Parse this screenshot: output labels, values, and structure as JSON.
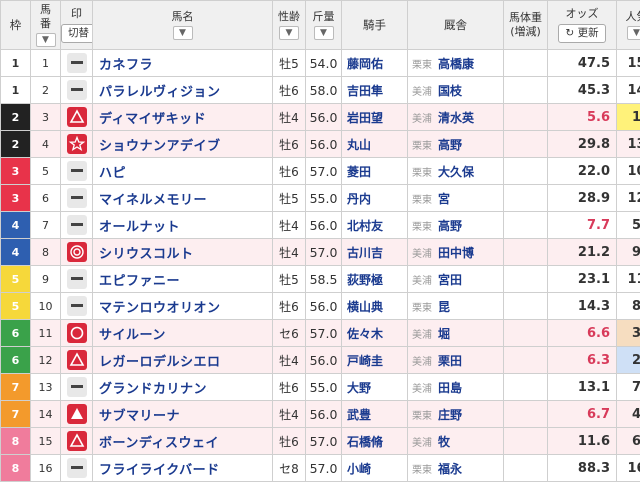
{
  "header": {
    "waku": "枠",
    "uma_top": "馬",
    "uma_bottom": "番",
    "mark_label": "印",
    "mark_toggle": "切替",
    "name": "馬名",
    "sex_age": "性齢",
    "kinryo": "斤量",
    "jockey": "騎手",
    "trainer": "厩舎",
    "weight_top": "馬体重",
    "weight_bottom": "(増減)",
    "odds": "オッズ",
    "update": "更新",
    "ninki": "人気"
  },
  "colors": {
    "waku": {
      "1": {
        "bg": "#ffffff",
        "fg": "#333333"
      },
      "2": {
        "bg": "#222222",
        "fg": "#ffffff"
      },
      "3": {
        "bg": "#e8334a",
        "fg": "#ffffff"
      },
      "4": {
        "bg": "#2e5fb0",
        "fg": "#ffffff"
      },
      "5": {
        "bg": "#f6d83a",
        "fg": "#ffffff"
      },
      "6": {
        "bg": "#3aa24a",
        "fg": "#ffffff"
      },
      "7": {
        "bg": "#f39a2c",
        "fg": "#ffffff"
      },
      "8": {
        "bg": "#f07c9c",
        "fg": "#ffffff"
      }
    },
    "ninki": {
      "1": "#fff27a",
      "2": "#cfe0f6",
      "3": "#f6ddc0"
    }
  },
  "rows": [
    {
      "waku": "1",
      "uma": "1",
      "mark": "none",
      "name": "カネフラ",
      "sex": "牡5",
      "kin": "54.0",
      "jockey": "藤岡佑",
      "area": "栗東",
      "trainer": "高橋康",
      "odds": "47.5",
      "hot": false,
      "ninki": "15",
      "pick": false
    },
    {
      "waku": "1",
      "uma": "2",
      "mark": "none",
      "name": "パラレルヴィジョン",
      "sex": "牡6",
      "kin": "58.0",
      "jockey": "吉田隼",
      "area": "美浦",
      "trainer": "国枝",
      "odds": "45.3",
      "hot": false,
      "ninki": "14",
      "pick": false
    },
    {
      "waku": "2",
      "uma": "3",
      "mark": "triangle",
      "name": "ディマイザキッド",
      "sex": "牡4",
      "kin": "56.0",
      "jockey": "岩田望",
      "area": "美浦",
      "trainer": "清水英",
      "odds": "5.6",
      "hot": true,
      "ninki": "1",
      "pick": true
    },
    {
      "waku": "2",
      "uma": "4",
      "mark": "star",
      "name": "ショウナンアデイブ",
      "sex": "牡6",
      "kin": "56.0",
      "jockey": "丸山",
      "area": "栗東",
      "trainer": "高野",
      "odds": "29.8",
      "hot": false,
      "ninki": "13",
      "pick": true
    },
    {
      "waku": "3",
      "uma": "5",
      "mark": "none",
      "name": "ハピ",
      "sex": "牡6",
      "kin": "57.0",
      "jockey": "菱田",
      "area": "栗東",
      "trainer": "大久保",
      "odds": "22.0",
      "hot": false,
      "ninki": "10",
      "pick": false
    },
    {
      "waku": "3",
      "uma": "6",
      "mark": "none",
      "name": "マイネルメモリー",
      "sex": "牡5",
      "kin": "55.0",
      "jockey": "丹内",
      "area": "栗東",
      "trainer": "宮",
      "odds": "28.9",
      "hot": false,
      "ninki": "12",
      "pick": false
    },
    {
      "waku": "4",
      "uma": "7",
      "mark": "none",
      "name": "オールナット",
      "sex": "牡4",
      "kin": "56.0",
      "jockey": "北村友",
      "area": "栗東",
      "trainer": "高野",
      "odds": "7.7",
      "hot": true,
      "ninki": "5",
      "pick": false
    },
    {
      "waku": "4",
      "uma": "8",
      "mark": "double",
      "name": "シリウスコルト",
      "sex": "牡4",
      "kin": "57.0",
      "jockey": "古川吉",
      "area": "美浦",
      "trainer": "田中博",
      "odds": "21.2",
      "hot": false,
      "ninki": "9",
      "pick": true
    },
    {
      "waku": "5",
      "uma": "9",
      "mark": "none",
      "name": "エピファニー",
      "sex": "牡5",
      "kin": "58.5",
      "jockey": "荻野極",
      "area": "美浦",
      "trainer": "宮田",
      "odds": "23.1",
      "hot": false,
      "ninki": "11",
      "pick": false
    },
    {
      "waku": "5",
      "uma": "10",
      "mark": "none",
      "name": "マテンロウオリオン",
      "sex": "牡6",
      "kin": "56.0",
      "jockey": "横山典",
      "area": "栗東",
      "trainer": "昆",
      "odds": "14.3",
      "hot": false,
      "ninki": "8",
      "pick": false
    },
    {
      "waku": "6",
      "uma": "11",
      "mark": "circle",
      "name": "サイルーン",
      "sex": "セ6",
      "kin": "57.0",
      "jockey": "佐々木",
      "area": "美浦",
      "trainer": "堀",
      "odds": "6.6",
      "hot": true,
      "ninki": "3",
      "pick": true
    },
    {
      "waku": "6",
      "uma": "12",
      "mark": "triangle",
      "name": "レガーロデルシエロ",
      "sex": "牡4",
      "kin": "56.0",
      "jockey": "戸崎圭",
      "area": "美浦",
      "trainer": "栗田",
      "odds": "6.3",
      "hot": true,
      "ninki": "2",
      "pick": true
    },
    {
      "waku": "7",
      "uma": "13",
      "mark": "none",
      "name": "グランドカリナン",
      "sex": "牡6",
      "kin": "55.0",
      "jockey": "大野",
      "area": "美浦",
      "trainer": "田島",
      "odds": "13.1",
      "hot": false,
      "ninki": "7",
      "pick": false
    },
    {
      "waku": "7",
      "uma": "14",
      "mark": "filltri",
      "name": "サブマリーナ",
      "sex": "牡4",
      "kin": "56.0",
      "jockey": "武豊",
      "area": "栗東",
      "trainer": "庄野",
      "odds": "6.7",
      "hot": true,
      "ninki": "4",
      "pick": true
    },
    {
      "waku": "8",
      "uma": "15",
      "mark": "triangle",
      "name": "ボーンディスウェイ",
      "sex": "牡6",
      "kin": "57.0",
      "jockey": "石橋脩",
      "area": "美浦",
      "trainer": "牧",
      "odds": "11.6",
      "hot": false,
      "ninki": "6",
      "pick": true
    },
    {
      "waku": "8",
      "uma": "16",
      "mark": "none",
      "name": "フライライクバード",
      "sex": "セ8",
      "kin": "57.0",
      "jockey": "小崎",
      "area": "栗東",
      "trainer": "福永",
      "odds": "88.3",
      "hot": false,
      "ninki": "16",
      "pick": false
    }
  ]
}
